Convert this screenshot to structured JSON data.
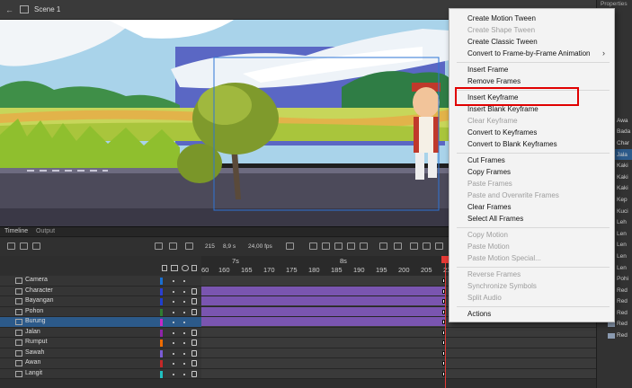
{
  "topbar": {
    "scene_label": "Scene 1"
  },
  "properties": {
    "title": "Properties",
    "tab": "4 - Co"
  },
  "library": {
    "items": [
      "Awa",
      "Bada",
      "Char",
      "Jala",
      "Kaki",
      "Kaki",
      "Kaki",
      "Kep",
      "Kuci",
      "Leh",
      "Len",
      "Len",
      "Len",
      "Len",
      "Pohi",
      "Red",
      "Red",
      "Red",
      "Red",
      "Red"
    ]
  },
  "timeline": {
    "tab_timeline": "Timeline",
    "tab_output": "Output",
    "frame": "215",
    "seconds": "8,9 s",
    "fps": "24,00 fps",
    "ruler_seconds": [
      "7s",
      "8s"
    ],
    "ruler_numbers": [
      "160",
      "165",
      "170",
      "175",
      "180",
      "185",
      "190",
      "195",
      "200",
      "205",
      "210",
      "215"
    ],
    "ruler_first": "60",
    "layers": [
      {
        "name": "Camera",
        "color": "#1a6fd1"
      },
      {
        "name": "Character",
        "color": "#2b3fd1"
      },
      {
        "name": "Bayangan",
        "color": "#1f3fcf"
      },
      {
        "name": "Pohon",
        "color": "#2e7d32"
      },
      {
        "name": "Burung",
        "color": "#c828c8"
      },
      {
        "name": "Jalan",
        "color": "#8e24aa"
      },
      {
        "name": "Rumput",
        "color": "#ef6c00"
      },
      {
        "name": "Sawah",
        "color": "#7b5cd6"
      },
      {
        "name": "Awan",
        "color": "#c62828"
      },
      {
        "name": "Langit",
        "color": "#20c0c0"
      }
    ]
  },
  "context_menu": {
    "items": [
      {
        "label": "Create Motion Tween",
        "enabled": true
      },
      {
        "label": "Create Shape Tween",
        "enabled": false
      },
      {
        "label": "Create Classic Tween",
        "enabled": true
      },
      {
        "label": "Convert to Frame-by-Frame Animation",
        "enabled": true,
        "submenu": true
      },
      {
        "label": "Insert Frame",
        "enabled": true
      },
      {
        "label": "Remove Frames",
        "enabled": true
      },
      {
        "label": "Insert Keyframe",
        "enabled": true,
        "highlighted": true
      },
      {
        "label": "Insert Blank Keyframe",
        "enabled": true
      },
      {
        "label": "Clear Keyframe",
        "enabled": false
      },
      {
        "label": "Convert to Keyframes",
        "enabled": true
      },
      {
        "label": "Convert to Blank Keyframes",
        "enabled": true
      },
      {
        "label": "Cut Frames",
        "enabled": true
      },
      {
        "label": "Copy Frames",
        "enabled": true
      },
      {
        "label": "Paste Frames",
        "enabled": false
      },
      {
        "label": "Paste and Overwrite Frames",
        "enabled": false
      },
      {
        "label": "Clear Frames",
        "enabled": true
      },
      {
        "label": "Select All Frames",
        "enabled": true
      },
      {
        "label": "Copy Motion",
        "enabled": false
      },
      {
        "label": "Paste Motion",
        "enabled": false
      },
      {
        "label": "Paste Motion Special...",
        "enabled": false
      },
      {
        "label": "Reverse Frames",
        "enabled": false
      },
      {
        "label": "Synchronize Symbols",
        "enabled": false
      },
      {
        "label": "Split Audio",
        "enabled": false
      },
      {
        "label": "Actions",
        "enabled": true
      }
    ],
    "submenu_glyph": "›",
    "highlight_color": "#e00000"
  },
  "colors": {
    "frame_span": "#7a55b0",
    "playhead": "#e53935",
    "selection": "#2c5a8a"
  }
}
